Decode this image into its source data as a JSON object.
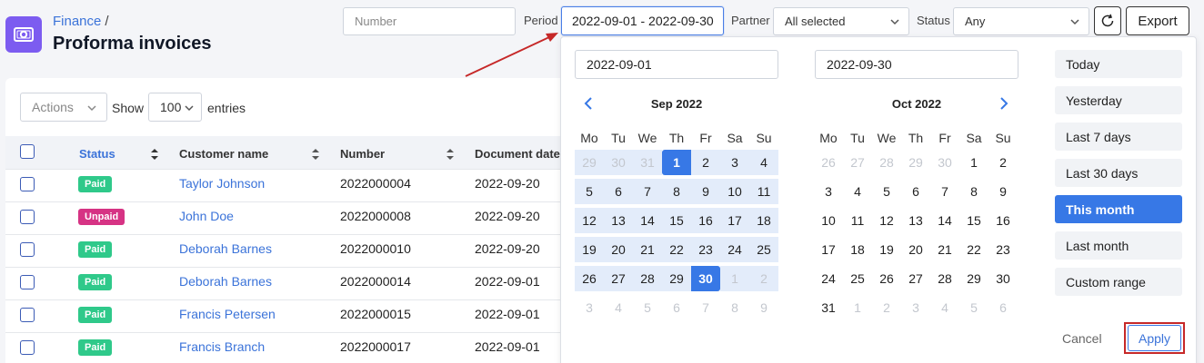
{
  "header": {
    "breadcrumb": "Finance",
    "breadcrumb_sep": "/",
    "title": "Proforma invoices",
    "icon": "invoice-cash-icon"
  },
  "filters": {
    "number_placeholder": "Number",
    "period_label": "Period",
    "period_value": "2022-09-01 - 2022-09-30",
    "partner_label": "Partner",
    "partner_value": "All selected",
    "status_label": "Status",
    "status_value": "Any",
    "refresh_icon": "refresh-icon",
    "export_label": "Export"
  },
  "toolbar": {
    "actions_label": "Actions",
    "show_label": "Show",
    "entries_value": "100",
    "entries_label": "entries"
  },
  "table": {
    "columns": [
      "Status",
      "Customer name",
      "Number",
      "Document date"
    ],
    "rows": [
      {
        "status": "Paid",
        "customer": "Taylor Johnson",
        "number": "2022000004",
        "date": "2022-09-20"
      },
      {
        "status": "Unpaid",
        "customer": "John Doe",
        "number": "2022000008",
        "date": "2022-09-20"
      },
      {
        "status": "Paid",
        "customer": "Deborah Barnes",
        "number": "2022000010",
        "date": "2022-09-20"
      },
      {
        "status": "Paid",
        "customer": "Deborah Barnes",
        "number": "2022000014",
        "date": "2022-09-01"
      },
      {
        "status": "Paid",
        "customer": "Francis Petersen",
        "number": "2022000015",
        "date": "2022-09-01"
      },
      {
        "status": "Paid",
        "customer": "Francis Branch",
        "number": "2022000017",
        "date": "2022-09-01"
      }
    ]
  },
  "datepicker": {
    "start_input": "2022-09-01",
    "end_input": "2022-09-30",
    "weekdays": [
      "Mo",
      "Tu",
      "We",
      "Th",
      "Fr",
      "Sa",
      "Su"
    ],
    "left_month": {
      "title": "Sep 2022",
      "weeks": [
        [
          "29",
          "30",
          "31",
          "1",
          "2",
          "3",
          "4"
        ],
        [
          "5",
          "6",
          "7",
          "8",
          "9",
          "10",
          "11"
        ],
        [
          "12",
          "13",
          "14",
          "15",
          "16",
          "17",
          "18"
        ],
        [
          "19",
          "20",
          "21",
          "22",
          "23",
          "24",
          "25"
        ],
        [
          "26",
          "27",
          "28",
          "29",
          "30",
          "1",
          "2"
        ],
        [
          "3",
          "4",
          "5",
          "6",
          "7",
          "8",
          "9"
        ]
      ]
    },
    "right_month": {
      "title": "Oct 2022",
      "weeks": [
        [
          "26",
          "27",
          "28",
          "29",
          "30",
          "1",
          "2"
        ],
        [
          "3",
          "4",
          "5",
          "6",
          "7",
          "8",
          "9"
        ],
        [
          "10",
          "11",
          "12",
          "13",
          "14",
          "15",
          "16"
        ],
        [
          "17",
          "18",
          "19",
          "20",
          "21",
          "22",
          "23"
        ],
        [
          "24",
          "25",
          "26",
          "27",
          "28",
          "29",
          "30"
        ],
        [
          "31",
          "1",
          "2",
          "3",
          "4",
          "5",
          "6"
        ]
      ]
    },
    "ranges": [
      "Today",
      "Yesterday",
      "Last 7 days",
      "Last 30 days",
      "This month",
      "Last month",
      "Custom range"
    ],
    "active_range": "This month",
    "cancel_label": "Cancel",
    "apply_label": "Apply"
  },
  "colors": {
    "accent": "#3778e6",
    "paid": "#2fc98a",
    "unpaid": "#d63384",
    "annotation": "#c62828"
  }
}
